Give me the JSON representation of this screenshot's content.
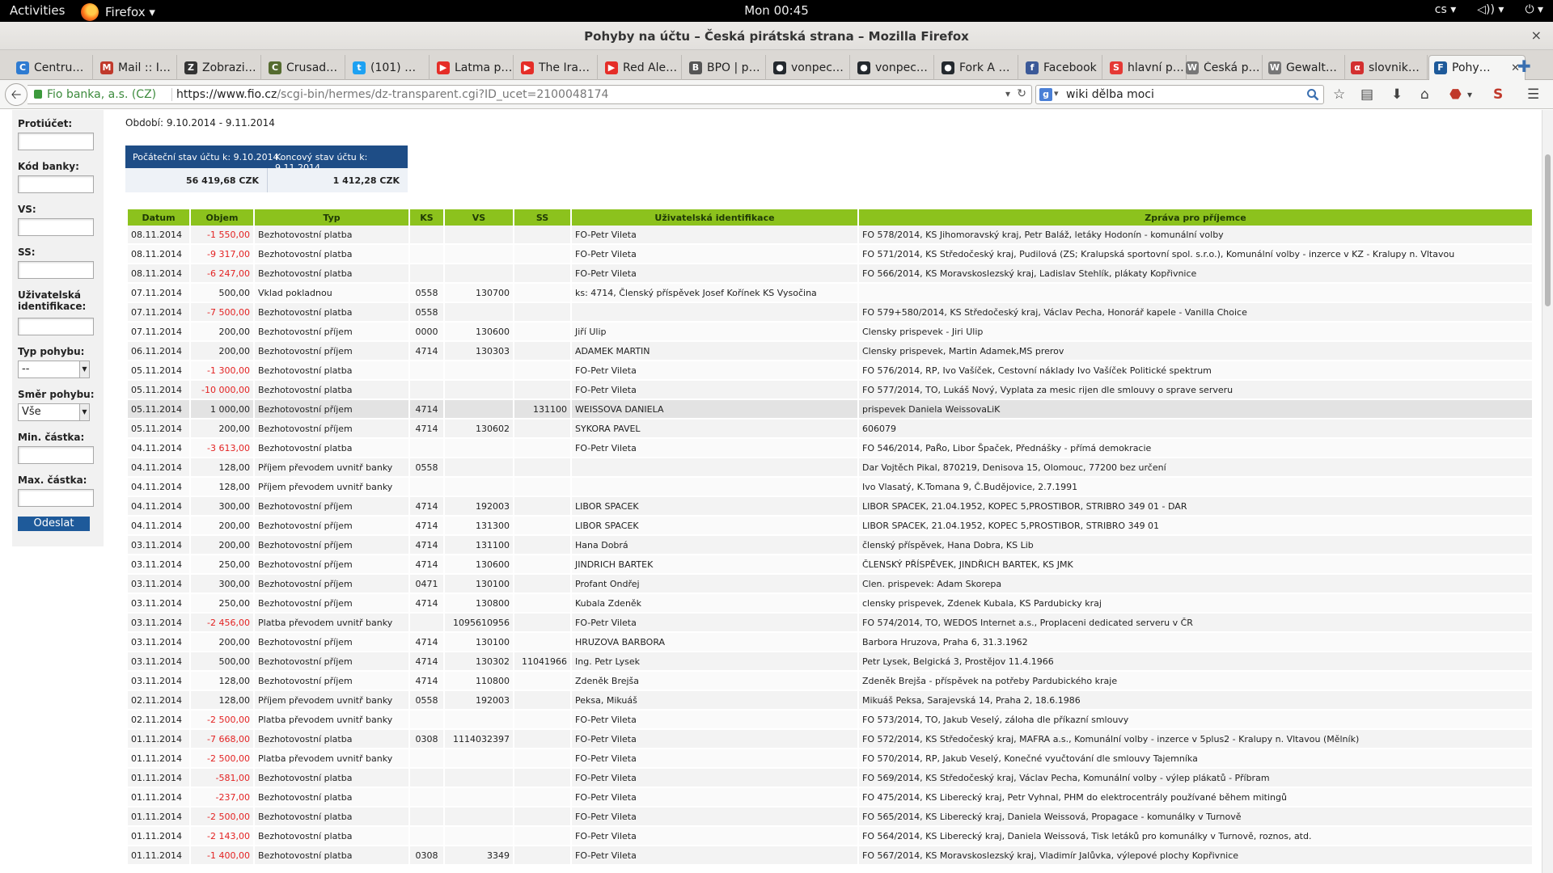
{
  "system_bar": {
    "activities": "Activities",
    "app_name": "Firefox ▾",
    "clock": "Mon 00:45",
    "lang": "cs ▾",
    "volume": "◁)) ▾",
    "power": "⏻ ▾"
  },
  "window": {
    "title": "Pohyby na účtu – Česká pirátská strana – Mozilla Firefox",
    "close": "×"
  },
  "tabs": [
    {
      "label": "Centru…",
      "icon_color": "#2e7bd1",
      "icon_char": "C"
    },
    {
      "label": "Mail :: I…",
      "icon_color": "#c0392b",
      "icon_char": "M"
    },
    {
      "label": "Zobrazi…",
      "icon_color": "#333333",
      "icon_char": "Z"
    },
    {
      "label": "Crusad…",
      "icon_color": "#556b2f",
      "icon_char": "C"
    },
    {
      "label": "(101) …",
      "icon_color": "#1da1f2",
      "icon_char": "t"
    },
    {
      "label": "Latma p…",
      "icon_color": "#e52d27",
      "icon_char": "▶"
    },
    {
      "label": "The Ira…",
      "icon_color": "#e52d27",
      "icon_char": "▶"
    },
    {
      "label": "Red Ale…",
      "icon_color": "#e52d27",
      "icon_char": "▶"
    },
    {
      "label": "BPÖ | p…",
      "icon_color": "#555555",
      "icon_char": "B"
    },
    {
      "label": "vonpec…",
      "icon_color": "#24292e",
      "icon_char": "●"
    },
    {
      "label": "vonpec…",
      "icon_color": "#24292e",
      "icon_char": "●"
    },
    {
      "label": "Fork A …",
      "icon_color": "#24292e",
      "icon_char": "●"
    },
    {
      "label": "Facebook",
      "icon_color": "#3b5998",
      "icon_char": "f"
    },
    {
      "label": "hlavní p…",
      "icon_color": "#e53935",
      "icon_char": "S"
    },
    {
      "label": "Česká p…",
      "icon_color": "#777777",
      "icon_char": "W"
    },
    {
      "label": "Gewalt…",
      "icon_color": "#777777",
      "icon_char": "W"
    },
    {
      "label": "slovnik…",
      "icon_color": "#d32f2f",
      "icon_char": "α"
    },
    {
      "label": "Pohy…",
      "icon_color": "#1e5a9a",
      "icon_char": "F",
      "active": true
    }
  ],
  "navbar": {
    "identity": "Fio banka, a.s. (CZ)",
    "url_host": "https://www.fio.cz",
    "url_path": "/scgi-bin/hermes/dz-transparent.cgi?ID_ucet=2100048174",
    "search_value": "wiki dělba moci"
  },
  "filters": {
    "protiucet": "Protiúčet:",
    "kod_banky": "Kód banky:",
    "vs": "VS:",
    "ss": "SS:",
    "uziv_ident": "Uživatelská identifikace:",
    "typ_pohybu": "Typ pohybu:",
    "typ_pohybu_value": "--",
    "smer_pohybu": "Směr pohybu:",
    "smer_pohybu_value": "Vše",
    "min_castka": "Min. částka:",
    "max_castka": "Max. částka:",
    "submit": "Odeslat"
  },
  "period": "Období: 9.10.2014 - 9.11.2014",
  "balance": {
    "start_label": "Počáteční stav účtu k: 9.10.2014",
    "end_label": "Koncový stav účtu k: 9.11.2014",
    "start_value": "56 419,68 CZK",
    "end_value": "1 412,28 CZK"
  },
  "table": {
    "columns": [
      "Datum",
      "Objem",
      "Typ",
      "KS",
      "VS",
      "SS",
      "Uživatelská identifikace",
      "Zpráva pro příjemce"
    ],
    "rows": [
      [
        "08.11.2014",
        "-1 550,00",
        "Bezhotovostní platba",
        "",
        "",
        "",
        "FO-Petr Vileta",
        "FO 578/2014, KS Jihomoravský kraj, Petr Baláž, letáky Hodonín - komunální volby"
      ],
      [
        "08.11.2014",
        "-9 317,00",
        "Bezhotovostní platba",
        "",
        "",
        "",
        "FO-Petr Vileta",
        "FO 571/2014, KS Středočeský kraj, Pudilová (ZS; Kralupská sportovní spol. s.r.o.), Komunální volby - inzerce v KZ - Kralupy n. Vltavou"
      ],
      [
        "08.11.2014",
        "-6 247,00",
        "Bezhotovostní platba",
        "",
        "",
        "",
        "FO-Petr Vileta",
        "FO 566/2014, KS Moravskoslezský kraj, Ladislav Stehlík, plákaty Kopřivnice"
      ],
      [
        "07.11.2014",
        "500,00",
        "Vklad pokladnou",
        "0558",
        "130700",
        "",
        "ks: 4714, Členský příspěvek Josef Kořínek KS Vysočina",
        ""
      ],
      [
        "07.11.2014",
        "-7 500,00",
        "Bezhotovostní platba",
        "0558",
        "",
        "",
        "",
        "FO 579+580/2014, KS Středočeský kraj, Václav Pecha, Honorář kapele - Vanilla Choice"
      ],
      [
        "07.11.2014",
        "200,00",
        "Bezhotovostní příjem",
        "0000",
        "130600",
        "",
        "Jiří Ulip",
        "Clensky prispevek - Jiri Ulip"
      ],
      [
        "06.11.2014",
        "200,00",
        "Bezhotovostní příjem",
        "4714",
        "130303",
        "",
        "ADAMEK MARTIN",
        "Clensky prispevek, Martin Adamek,MS prerov"
      ],
      [
        "05.11.2014",
        "-1 300,00",
        "Bezhotovostní platba",
        "",
        "",
        "",
        "FO-Petr Vileta",
        "FO 576/2014, RP, Ivo Vašíček, Cestovní náklady Ivo Vašíček Politické spektrum"
      ],
      [
        "05.11.2014",
        "-10 000,00",
        "Bezhotovostní platba",
        "",
        "",
        "",
        "FO-Petr Vileta",
        "FO 577/2014, TO, Lukáš Nový, Vyplata za mesic rijen dle smlouvy o sprave serveru"
      ],
      [
        "05.11.2014",
        "1 000,00",
        "Bezhotovostní příjem",
        "4714",
        "",
        "131100",
        "WEISSOVA DANIELA",
        "prispevek Daniela WeissovaLiK"
      ],
      [
        "05.11.2014",
        "200,00",
        "Bezhotovostní příjem",
        "4714",
        "130602",
        "",
        "SYKORA PAVEL",
        "606079"
      ],
      [
        "04.11.2014",
        "-3 613,00",
        "Bezhotovostní platba",
        "",
        "",
        "",
        "FO-Petr Vileta",
        "FO 546/2014, PaŘo, Libor Špaček, Přednášky - přímá demokracie"
      ],
      [
        "04.11.2014",
        "128,00",
        "Příjem převodem uvnitř banky",
        "0558",
        "",
        "",
        "",
        "Dar Vojtěch Pikal, 870219, Denisova 15, Olomouc, 77200 bez určení"
      ],
      [
        "04.11.2014",
        "128,00",
        "Příjem převodem uvnitř banky",
        "",
        "",
        "",
        "",
        "Ivo Vlasatý, K.Tomana 9, Č.Budějovice, 2.7.1991"
      ],
      [
        "04.11.2014",
        "300,00",
        "Bezhotovostní příjem",
        "4714",
        "192003",
        "",
        "LIBOR SPACEK",
        "LIBOR SPACEK, 21.04.1952, KOPEC 5,PROSTIBOR, STRIBRO 349 01 - DAR"
      ],
      [
        "04.11.2014",
        "200,00",
        "Bezhotovostní příjem",
        "4714",
        "131300",
        "",
        "LIBOR SPACEK",
        "LIBOR SPACEK, 21.04.1952, KOPEC 5,PROSTIBOR, STRIBRO 349 01"
      ],
      [
        "03.11.2014",
        "200,00",
        "Bezhotovostní příjem",
        "4714",
        "131100",
        "",
        "Hana Dobrá",
        "členský příspěvek, Hana Dobra, KS Lib"
      ],
      [
        "03.11.2014",
        "250,00",
        "Bezhotovostní příjem",
        "4714",
        "130600",
        "",
        "JINDRICH BARTEK",
        "ČLENSKÝ PŘÍSPĚVEK, JINDŘICH BARTEK, KS JMK"
      ],
      [
        "03.11.2014",
        "300,00",
        "Bezhotovostní příjem",
        "0471",
        "130100",
        "",
        "Profant Ondřej",
        "Clen. prispevek: Adam Skorepa"
      ],
      [
        "03.11.2014",
        "250,00",
        "Bezhotovostní příjem",
        "4714",
        "130800",
        "",
        "Kubala Zdeněk",
        "clensky prispevek, Zdenek Kubala, KS Pardubicky kraj"
      ],
      [
        "03.11.2014",
        "-2 456,00",
        "Platba převodem uvnitř banky",
        "",
        "1095610956",
        "",
        "FO-Petr Vileta",
        "FO 574/2014, TO, WEDOS Internet a.s., Proplaceni dedicated serveru v ČR"
      ],
      [
        "03.11.2014",
        "200,00",
        "Bezhotovostní příjem",
        "4714",
        "130100",
        "",
        "HRUZOVA BARBORA",
        "Barbora Hruzova, Praha 6, 31.3.1962"
      ],
      [
        "03.11.2014",
        "500,00",
        "Bezhotovostní příjem",
        "4714",
        "130302",
        "11041966",
        "Ing. Petr Lysek",
        "Petr Lysek, Belgická 3, Prostějov 11.4.1966"
      ],
      [
        "03.11.2014",
        "128,00",
        "Bezhotovostní příjem",
        "4714",
        "110800",
        "",
        "Zdeněk Brejša",
        "Zdeněk Brejša - příspěvek na potřeby Pardubického kraje"
      ],
      [
        "02.11.2014",
        "128,00",
        "Příjem převodem uvnitř banky",
        "0558",
        "192003",
        "",
        "Peksa, Mikuáš",
        "Mikuáš Peksa, Sarajevská 14, Praha 2, 18.6.1986"
      ],
      [
        "02.11.2014",
        "-2 500,00",
        "Platba převodem uvnitř banky",
        "",
        "",
        "",
        "FO-Petr Vileta",
        "FO 573/2014, TO, Jakub Veselý, záloha dle příkazní smlouvy"
      ],
      [
        "01.11.2014",
        "-7 668,00",
        "Bezhotovostní platba",
        "0308",
        "1114032397",
        "",
        "FO-Petr Vileta",
        "FO 572/2014, KS Středočeský kraj, MAFRA a.s., Komunální volby - inzerce v 5plus2 - Kralupy n. Vltavou (Mělník)"
      ],
      [
        "01.11.2014",
        "-2 500,00",
        "Platba převodem uvnitř banky",
        "",
        "",
        "",
        "FO-Petr Vileta",
        "FO 570/2014, RP, Jakub Veselý, Konečné vyučtování dle smlouvy Tajemníka"
      ],
      [
        "01.11.2014",
        "-581,00",
        "Bezhotovostní platba",
        "",
        "",
        "",
        "FO-Petr Vileta",
        "FO 569/2014, KS Středočeský kraj, Václav Pecha, Komunální volby - výlep plákatů - Příbram"
      ],
      [
        "01.11.2014",
        "-237,00",
        "Bezhotovostní platba",
        "",
        "",
        "",
        "FO-Petr Vileta",
        "FO 475/2014, KS Liberecký kraj, Petr Vyhnal, PHM do elektrocentrály používané během mitingů"
      ],
      [
        "01.11.2014",
        "-2 500,00",
        "Bezhotovostní platba",
        "",
        "",
        "",
        "FO-Petr Vileta",
        "FO 565/2014, KS Liberecký kraj, Daniela Weissová, Propagace - komunálky v Turnově"
      ],
      [
        "01.11.2014",
        "-2 143,00",
        "Bezhotovostní platba",
        "",
        "",
        "",
        "FO-Petr Vileta",
        "FO 564/2014, KS Liberecký kraj, Daniela Weissová, Tisk letáků pro komunálky v Turnově, roznos, atd."
      ],
      [
        "01.11.2014",
        "-1 400,00",
        "Bezhotovostní platba",
        "0308",
        "3349",
        "",
        "FO-Petr Vileta",
        "FO 567/2014, KS Moravskoslezský kraj, Vladimír Jalůvka, výlepové plochy Kopřivnice"
      ]
    ]
  }
}
